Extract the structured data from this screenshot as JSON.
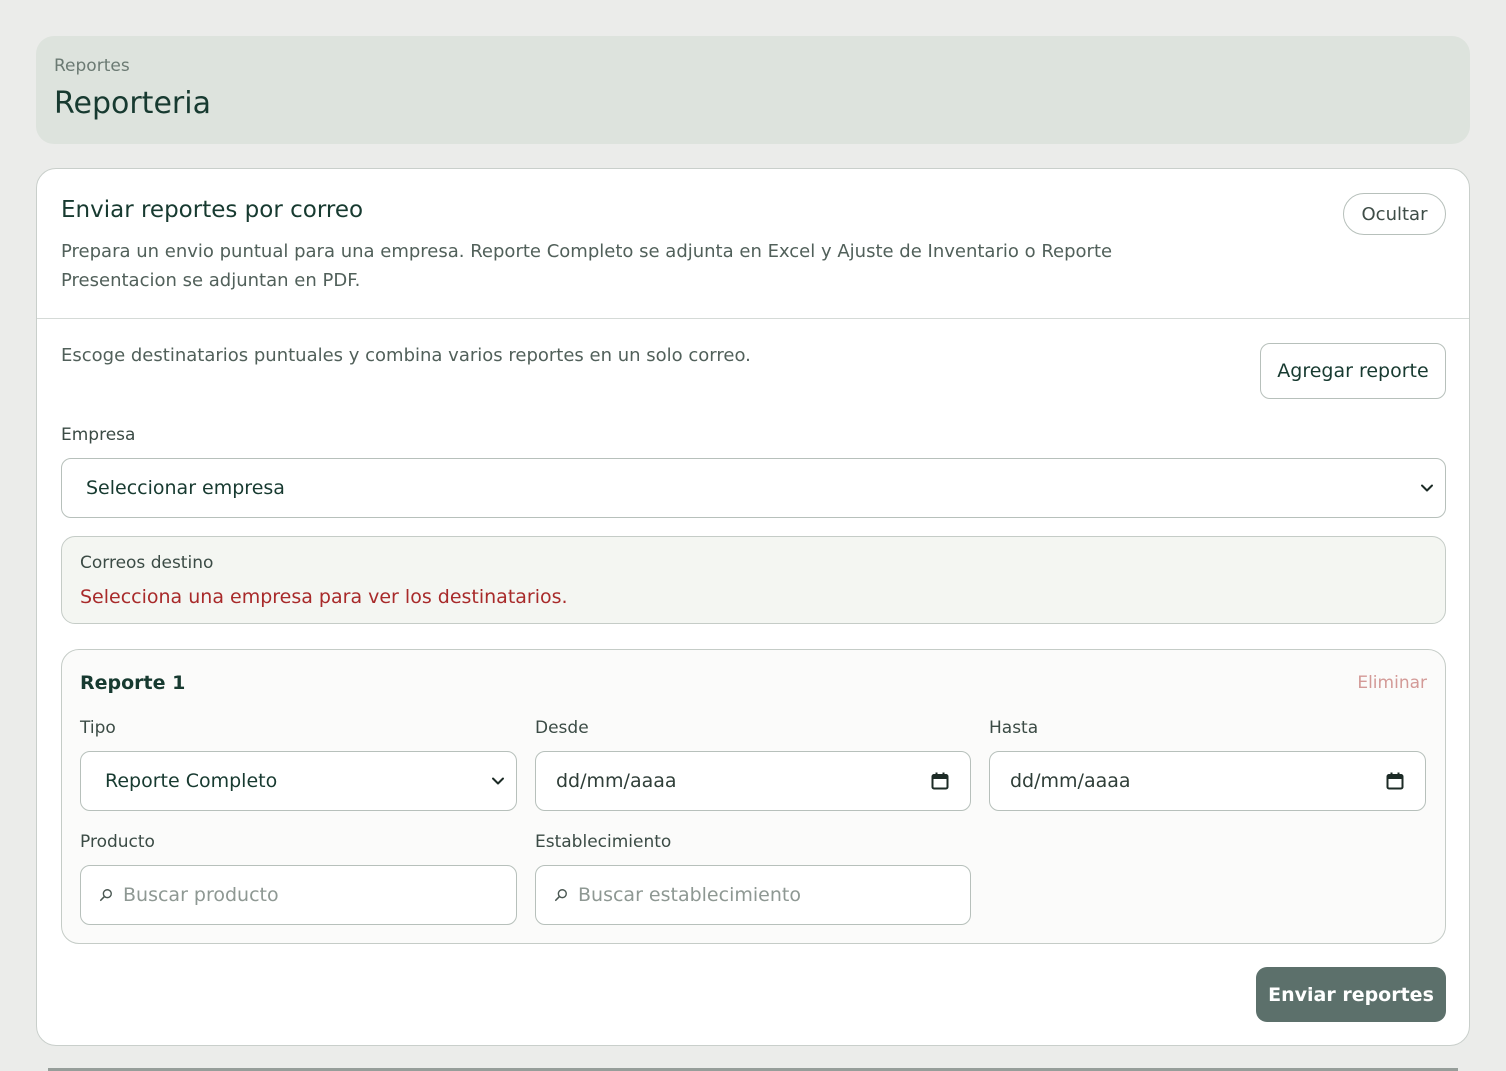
{
  "header": {
    "breadcrumb": "Reportes",
    "title": "Reporteria"
  },
  "card": {
    "title": "Enviar reportes por correo",
    "description": "Prepara un envio puntual para una empresa. Reporte Completo se adjunta en Excel y Ajuste de Inventario o Reporte Presentacion se adjuntan en PDF.",
    "hide_label": "Ocultar",
    "hint": "Escoge destinatarios puntuales y combina varios reportes en un solo correo.",
    "add_report_label": "Agregar reporte",
    "company_label": "Empresa",
    "company_value": "Seleccionar empresa",
    "recipients": {
      "label": "Correos destino",
      "message": "Selecciona una empresa para ver los destinatarios."
    },
    "report": {
      "title": "Reporte 1",
      "delete_label": "Eliminar",
      "type_label": "Tipo",
      "type_value": "Reporte Completo",
      "from_label": "Desde",
      "from_value": "dd/mm/aaaa",
      "to_label": "Hasta",
      "to_value": "dd/mm/aaaa",
      "product_label": "Producto",
      "product_placeholder": "Buscar producto",
      "establishment_label": "Establecimiento",
      "establishment_placeholder": "Buscar establecimiento"
    },
    "send_label": "Enviar reportes"
  },
  "colors": {
    "accent_button": "#5c706b",
    "error_text": "#a82a2a",
    "delete_link": "#d39a97",
    "header_bg": "#dde3dd"
  },
  "icons": {
    "select_chevron": "chevron-down-icon",
    "date_picker": "calendar-icon",
    "search": "search-icon"
  }
}
